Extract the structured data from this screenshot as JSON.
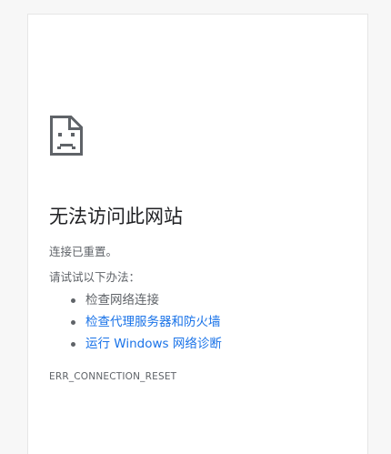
{
  "error_page": {
    "icon": "sad-document-icon",
    "title": "无法访问此网站",
    "subtitle": "连接已重置。",
    "try_label": "请试试以下办法：",
    "suggestions": [
      {
        "label": "检查网络连接",
        "is_link": false
      },
      {
        "label": "检查代理服务器和防火墙",
        "is_link": true
      },
      {
        "label": "运行 Windows 网络诊断",
        "is_link": true
      }
    ],
    "error_code": "ERR_CONNECTION_RESET"
  },
  "colors": {
    "background": "#f7f7f7",
    "card": "#ffffff",
    "title": "#202124",
    "text": "#5f6368",
    "link": "#1a73e8"
  }
}
